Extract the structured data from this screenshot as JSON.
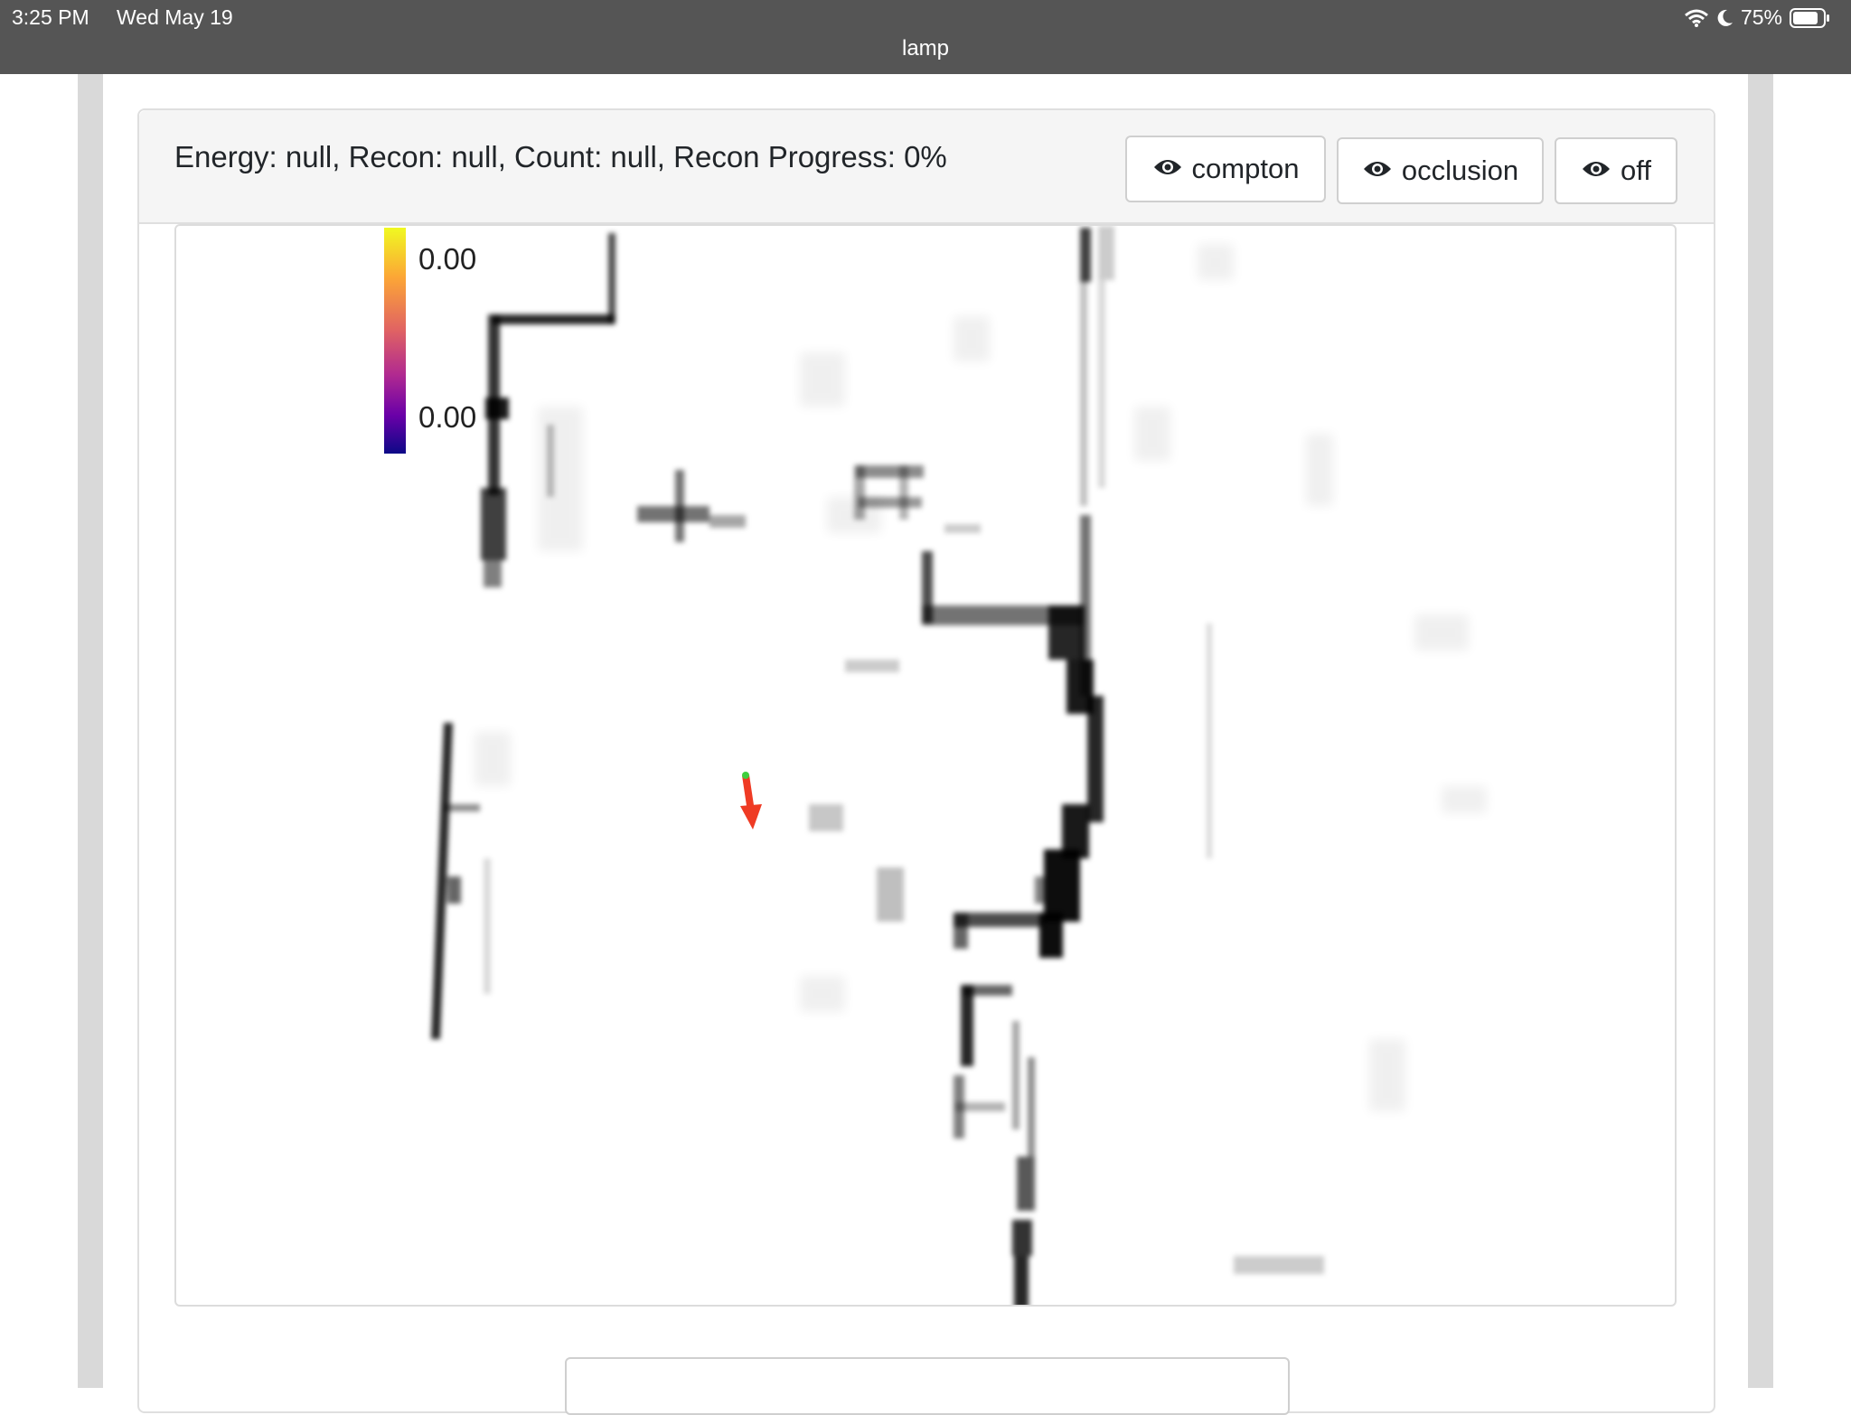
{
  "status_bar": {
    "time": "3:25 PM",
    "date": "Wed May 19",
    "title": "lamp",
    "battery": "75%",
    "icons": [
      "wifi-icon",
      "moon-icon",
      "battery-icon"
    ]
  },
  "header": {
    "status": "Energy: null, Recon: null, Count: null, Recon Progress: 0%",
    "buttons": [
      {
        "label": "compton",
        "icon": "eye-icon"
      },
      {
        "label": "occlusion",
        "icon": "eye-icon"
      },
      {
        "label": "off",
        "icon": "eye-icon"
      }
    ]
  },
  "map": {
    "colorbar": {
      "max_label": "0.00",
      "min_label": "0.00",
      "colormap": "plasma"
    },
    "pose_marker": {
      "color": "#ef3b24",
      "heading": "down"
    }
  }
}
